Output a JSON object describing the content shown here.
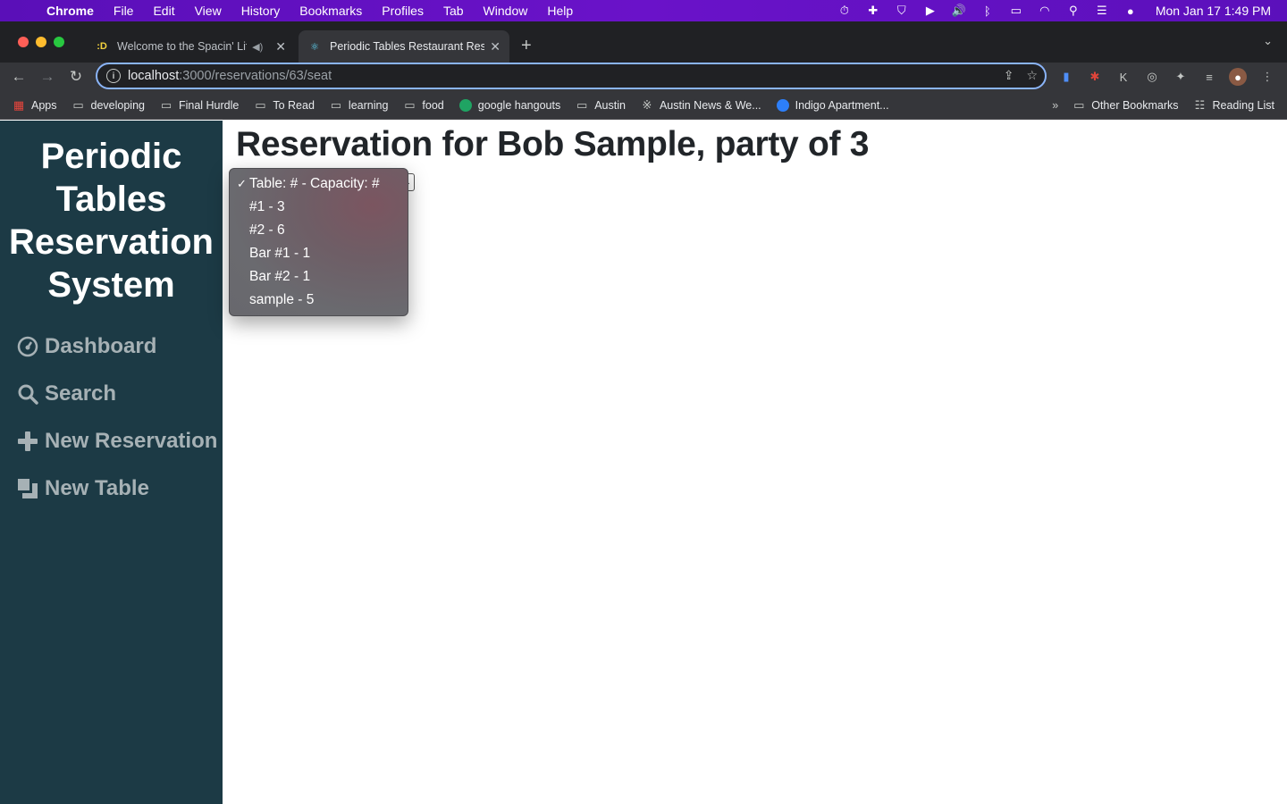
{
  "menubar": {
    "app_name": "Chrome",
    "menus": [
      "File",
      "Edit",
      "View",
      "History",
      "Bookmarks",
      "Profiles",
      "Tab",
      "Window",
      "Help"
    ],
    "clock": "Mon Jan 17  1:49 PM"
  },
  "tabs": {
    "inactive": {
      "title": "Welcome to the Spacin' Lif",
      "favicon": ":D"
    },
    "active": {
      "title": "Periodic Tables Restaurant Res"
    }
  },
  "toolbar": {
    "url_host": "localhost",
    "url_path": ":3000/reservations/63/seat"
  },
  "bookmarks": {
    "items": [
      "Apps",
      "developing",
      "Final Hurdle",
      "To Read",
      "learning",
      "food",
      "google hangouts",
      "Austin",
      "Austin News & We...",
      "Indigo Apartment..."
    ],
    "other": "Other Bookmarks",
    "reading_list": "Reading List"
  },
  "sidebar": {
    "brand_lines": [
      "Periodic",
      "Tables",
      "Reservation",
      "System"
    ],
    "nav": [
      "Dashboard",
      "Search",
      "New Reservation",
      "New Table"
    ]
  },
  "main": {
    "heading": "Reservation for Bob Sample, party of 3"
  },
  "dropdown": {
    "options": [
      "Table: # - Capacity: #",
      "#1 - 3",
      "#2 - 6",
      "Bar #1 - 1",
      "Bar #2 - 1",
      "sample - 5"
    ]
  },
  "colors": {
    "sidebar_bg": "#1c3a45",
    "nav_link": "#a6b1b5",
    "menubar": "#6a12c9",
    "omnibox_focus": "#8ab4f8"
  }
}
